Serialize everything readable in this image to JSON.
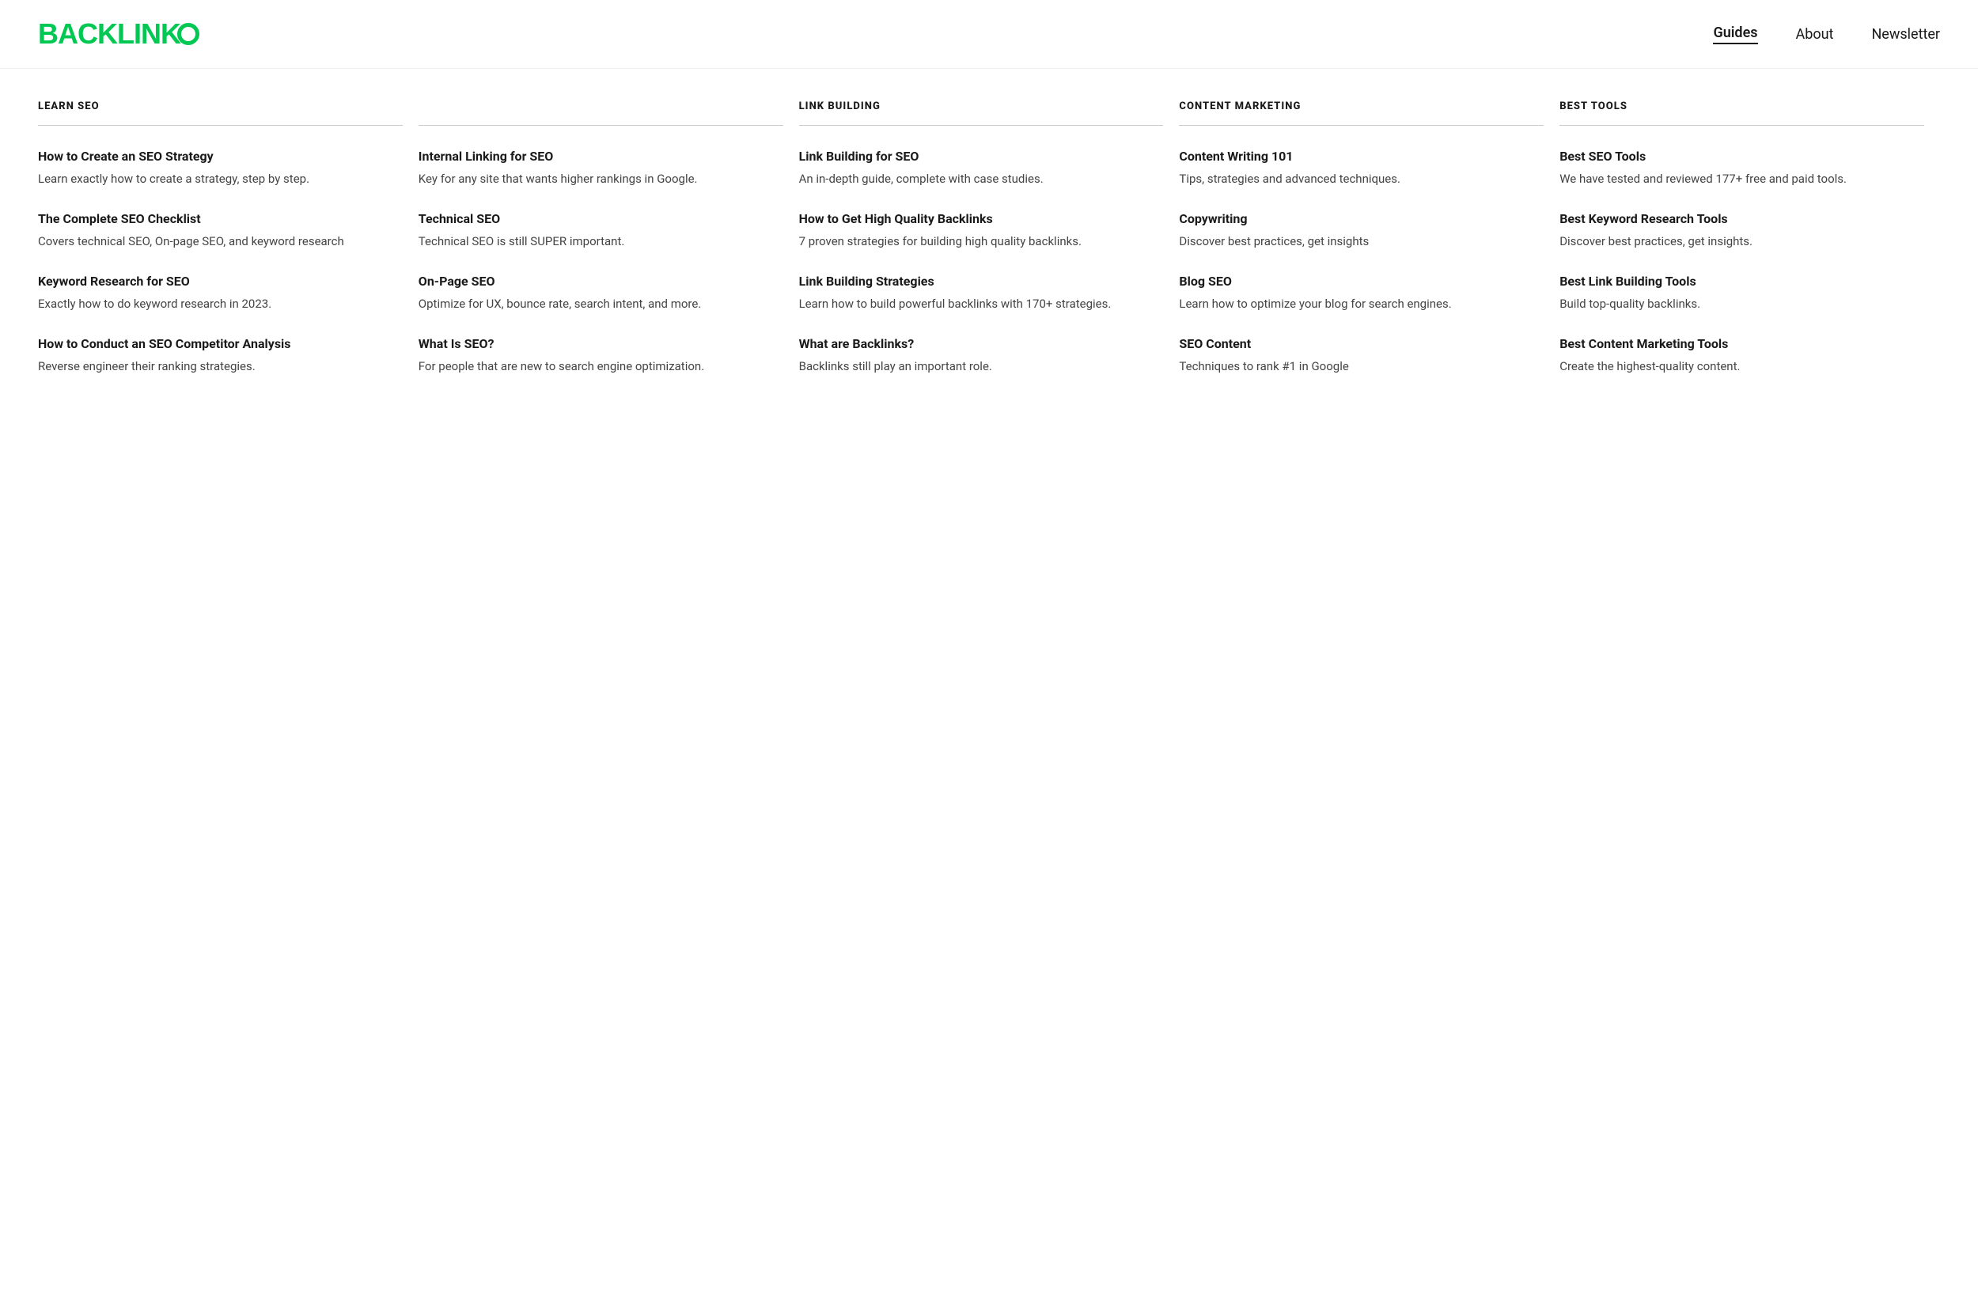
{
  "header": {
    "logo_text": "BACKLINK",
    "nav": [
      {
        "label": "Guides",
        "active": true
      },
      {
        "label": "About",
        "active": false
      },
      {
        "label": "Newsletter",
        "active": false
      }
    ]
  },
  "columns": [
    {
      "id": "learn-seo-1",
      "header": "LEARN SEO",
      "items": [
        {
          "title": "How to Create an SEO Strategy",
          "desc": "Learn exactly how to create a strategy, step by step."
        },
        {
          "title": "The Complete SEO Checklist",
          "desc": "Covers technical SEO, On-page SEO, and keyword research"
        },
        {
          "title": "Keyword Research for SEO",
          "desc": "Exactly how to do keyword research in 2023."
        },
        {
          "title": "How to Conduct an SEO Competitor Analysis",
          "desc": "Reverse engineer their ranking strategies."
        }
      ]
    },
    {
      "id": "learn-seo-2",
      "header": "",
      "items": [
        {
          "title": "Internal Linking for SEO",
          "desc": "Key for any site that wants higher rankings in Google."
        },
        {
          "title": "Technical SEO",
          "desc": "Technical SEO is still SUPER important."
        },
        {
          "title": "On-Page SEO",
          "desc": "Optimize for UX, bounce rate, search intent, and more."
        },
        {
          "title": "What Is SEO?",
          "desc": "For people that are new to search engine optimization."
        }
      ]
    },
    {
      "id": "link-building",
      "header": "LINK BUILDING",
      "items": [
        {
          "title": "Link Building for SEO",
          "desc": "An in-depth guide, complete with case studies."
        },
        {
          "title": "How to Get High Quality Backlinks",
          "desc": "7 proven strategies for building high quality backlinks."
        },
        {
          "title": "Link Building Strategies",
          "desc": "Learn how to build powerful backlinks with 170+ strategies."
        },
        {
          "title": "What are Backlinks?",
          "desc": "Backlinks still play an important role."
        }
      ]
    },
    {
      "id": "content-marketing",
      "header": "CONTENT MARKETING",
      "items": [
        {
          "title": "Content Writing 101",
          "desc": "Tips, strategies and advanced techniques."
        },
        {
          "title": "Copywriting",
          "desc": "Discover best practices, get insights"
        },
        {
          "title": "Blog SEO",
          "desc": "Learn how to optimize your blog for search engines."
        },
        {
          "title": "SEO Content",
          "desc": "Techniques to rank #1 in Google"
        }
      ]
    },
    {
      "id": "best-tools",
      "header": "BEST TOOLS",
      "items": [
        {
          "title": "Best SEO Tools",
          "desc": "We have tested and reviewed 177+ free and paid tools."
        },
        {
          "title": "Best Keyword Research Tools",
          "desc": "Discover best practices, get insights."
        },
        {
          "title": "Best Link Building Tools",
          "desc": "Build top-quality backlinks."
        },
        {
          "title": "Best Content Marketing Tools",
          "desc": "Create the highest-quality content."
        }
      ]
    }
  ]
}
